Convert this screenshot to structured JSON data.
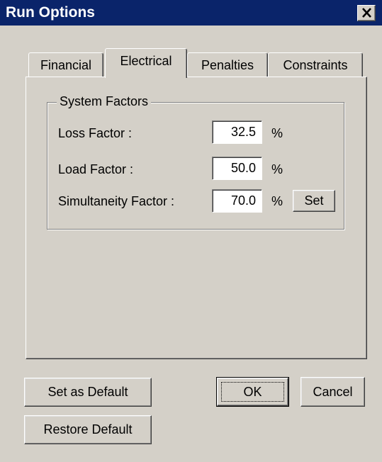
{
  "window": {
    "title": "Run Options"
  },
  "tabs": [
    {
      "label": "Financial",
      "selected": false
    },
    {
      "label": "Electrical",
      "selected": true
    },
    {
      "label": "Penalties",
      "selected": false
    },
    {
      "label": "Constraints",
      "selected": false
    }
  ],
  "group": {
    "title": "System Factors",
    "fields": [
      {
        "label": "Loss Factor :",
        "value": "32.5",
        "unit": "%"
      },
      {
        "label": "Load Factor :",
        "value": "50.0",
        "unit": "%"
      },
      {
        "label": "Simultaneity Factor :",
        "value": "70.0",
        "unit": "%",
        "button": "Set"
      }
    ]
  },
  "buttons": {
    "set_default": "Set as Default",
    "restore_default": "Restore Default",
    "ok": "OK",
    "cancel": "Cancel"
  },
  "colors": {
    "titlebar": "#0a246a",
    "face": "#d4d0c8"
  }
}
